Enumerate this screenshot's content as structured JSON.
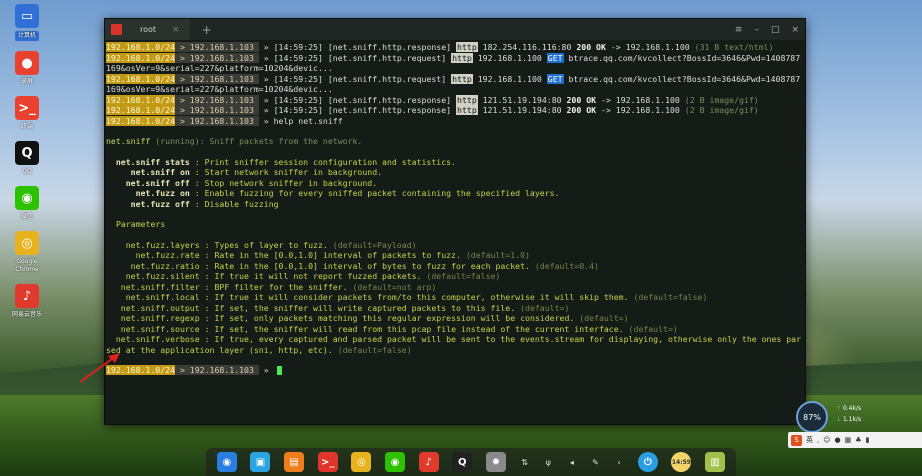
{
  "desktop": {
    "icons": [
      {
        "label": "计算机",
        "icon": "computer-icon",
        "color": "#2f6fd6",
        "selected": true
      },
      {
        "label": "录屏",
        "icon": "screen-record-icon",
        "color": "#e8412f"
      },
      {
        "label": "终端",
        "icon": "terminal-icon",
        "color": "#e8412f"
      },
      {
        "label": "QQ",
        "icon": "qq-icon",
        "color": "#111111"
      },
      {
        "label": "微信",
        "icon": "wechat-icon",
        "color": "#2dc100"
      },
      {
        "label": "Google Chrome",
        "icon": "chrome-icon",
        "color": "#e8b21e"
      },
      {
        "label": "网易云音乐",
        "icon": "netease-music-icon",
        "color": "#e03a2c"
      }
    ]
  },
  "terminal": {
    "tab_title": "root",
    "tab_close": "×",
    "tab_add": "+",
    "win_menu": "≡",
    "win_min": "–",
    "win_max": "□",
    "win_close": "×",
    "prompt_subnet": "192.168.1.0/24",
    "prompt_sep": " > ",
    "prompt_ip": "192.168.1.103",
    "prompt_arrow": " » ",
    "log": [
      {
        "time": "[14:59:25]",
        "event": "[net.sniff.http.response]",
        "proto": "http",
        "src": "182.254.116.116:80",
        "status": "200 OK",
        "arrow": "->",
        "dst": "192.168.1.100",
        "tail": "(31 B text/html)"
      },
      {
        "time": "[14:59:25]",
        "event": "[net.sniff.http.request]",
        "proto": "http",
        "src": "192.168.1.100",
        "method": "GET",
        "url": "btrace.qq.com/kvcollect?BossId=3646&Pwd=1408787169&osVer=9&serial=227&platform=10204&devic..."
      },
      {
        "time": "[14:59:25]",
        "event": "[net.sniff.http.request]",
        "proto": "http",
        "src": "192.168.1.100",
        "method": "GET",
        "url": "btrace.qq.com/kvcollect?BossId=3646&Pwd=1408787169&osVer=9&serial=227&platform=10204&devic..."
      },
      {
        "time": "[14:59:25]",
        "event": "[net.sniff.http.response]",
        "proto": "http",
        "src": "121.51.19.194:80",
        "status": "200 OK",
        "arrow": "->",
        "dst": "192.168.1.100",
        "tail": "(2 B image/gif)"
      },
      {
        "time": "[14:59:25]",
        "event": "[net.sniff.http.response]",
        "proto": "http",
        "src": "121.51.19.194:80",
        "status": "200 OK",
        "arrow": "->",
        "dst": "192.168.1.100",
        "tail": "(2 B image/gif)"
      }
    ],
    "command": "help net.sniff",
    "module_name": "net.sniff",
    "module_state": "(running)",
    "module_desc": ": Sniff packets from the network.",
    "commands": [
      {
        "name": "net.sniff stats",
        "desc": ": Print sniffer session configuration and statistics."
      },
      {
        "name": "net.sniff on",
        "desc": ": Start network sniffer in background."
      },
      {
        "name": "net.sniff off",
        "desc": ": Stop network sniffer in background."
      },
      {
        "name": "net.fuzz on",
        "desc": ": Enable fuzzing for every sniffed packet containing the specified layers."
      },
      {
        "name": "net.fuzz off",
        "desc": ": Disable fuzzing"
      }
    ],
    "params_heading": "Parameters",
    "params": [
      {
        "name": "net.fuzz.layers",
        "desc": ": Types of layer to fuzz.",
        "def": "(default=Payload)"
      },
      {
        "name": "net.fuzz.rate",
        "desc": ": Rate in the [0.0,1.0] interval of packets to fuzz.",
        "def": "(default=1.0)"
      },
      {
        "name": "net.fuzz.ratio",
        "desc": ": Rate in the [0.0,1.0] interval of bytes to fuzz for each packet.",
        "def": "(default=0.4)"
      },
      {
        "name": "net.fuzz.silent",
        "desc": ": If true it will not report fuzzed packets.",
        "def": "(default=false)"
      },
      {
        "name": "net.sniff.filter",
        "desc": ": BPF filter for the sniffer.",
        "def": "(default=not arp)"
      },
      {
        "name": "net.sniff.local",
        "desc": ": If true it will consider packets from/to this computer, otherwise it will skip them.",
        "def": "(default=false)"
      },
      {
        "name": "net.sniff.output",
        "desc": ": If set, the sniffer will write captured packets to this file.",
        "def": "(default=)"
      },
      {
        "name": "net.sniff.regexp",
        "desc": ": If set, only packets matching this regular expression will be considered.",
        "def": "(default=)"
      },
      {
        "name": "net.sniff.source",
        "desc": ": If set, the sniffer will read from this pcap file instead of the current interface.",
        "def": "(default=)"
      },
      {
        "name": "net.sniff.verbose",
        "desc": ": If true, every captured and parsed packet will be sent to the events.stream for displaying, otherwise only the ones parsed at the application layer (sni, http, etc).",
        "def": "(default=false)"
      }
    ]
  },
  "dock": {
    "items": [
      "launcher-icon",
      "file-manager-icon",
      "store-icon",
      "terminal-icon",
      "chrome-icon",
      "wechat-icon",
      "netease-music-icon",
      "qq-icon",
      "settings-icon",
      "network-icon",
      "usb-icon",
      "volume-icon",
      "pen-icon",
      "arrow-icon",
      "power-icon",
      "clock-icon",
      "trash-icon"
    ],
    "clock": "14:59"
  },
  "tray": {
    "gauge": "87%",
    "upload": "0.4k/s",
    "download": "1.1k/s",
    "ime": "英"
  }
}
